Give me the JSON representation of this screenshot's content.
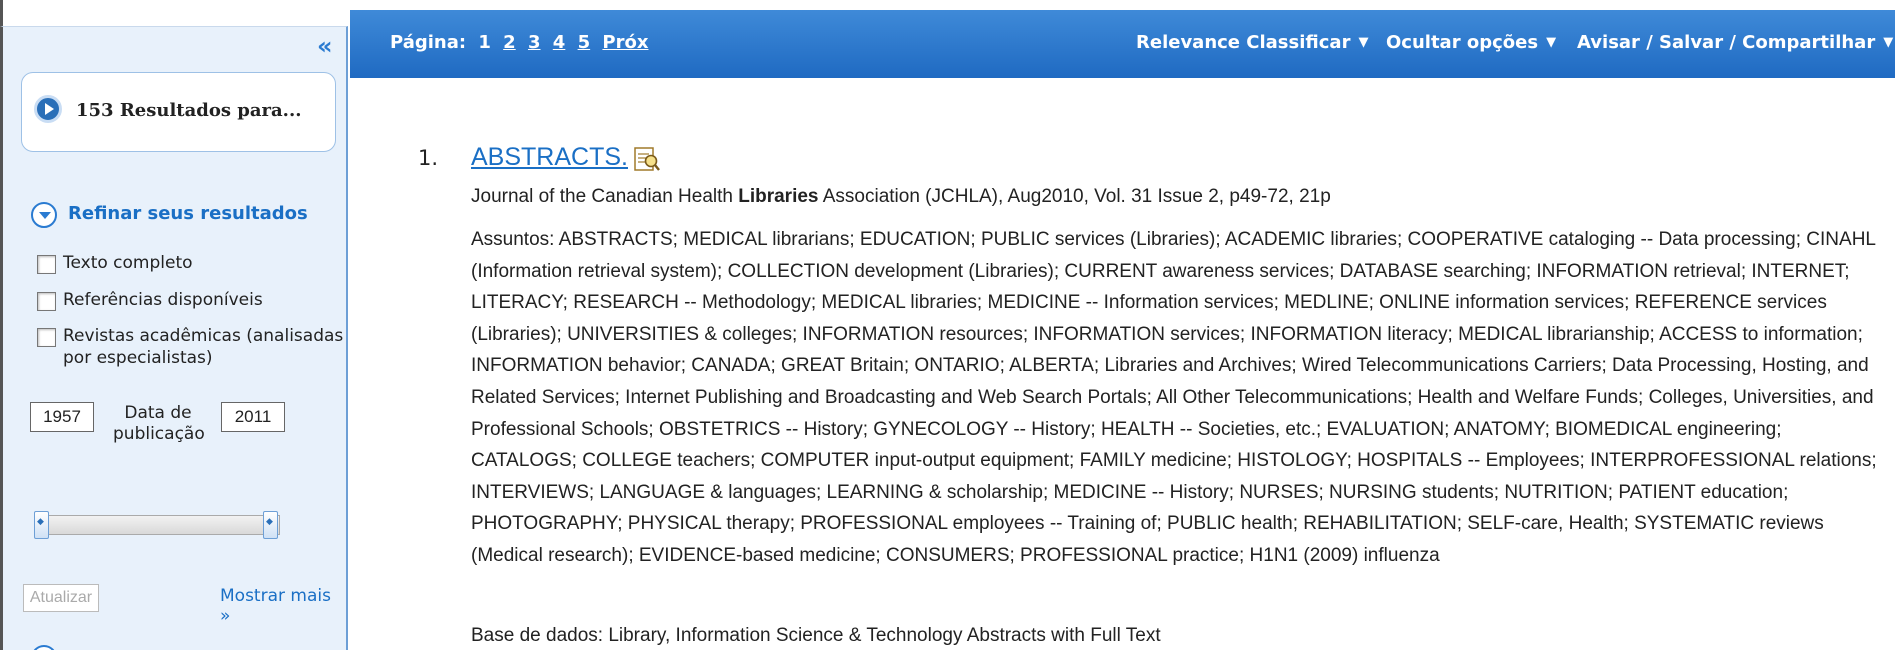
{
  "sidebar": {
    "collapse_glyph": "«",
    "results_label": "153 Resultados para...",
    "refine_label": "Refinar seus resultados",
    "filters": [
      {
        "label": "Texto completo",
        "checked": false
      },
      {
        "label": "Referências disponíveis",
        "checked": false
      },
      {
        "label": "Revistas acadêmicas (analisadas por especialistas)",
        "checked": false
      }
    ],
    "date_from": "1957",
    "date_to": "2011",
    "date_label": "Data de publicação",
    "update_button": "Atualizar",
    "show_more": "Mostrar mais »"
  },
  "toolbar": {
    "page_label": "Página:",
    "current_page": "1",
    "pages": [
      "2",
      "3",
      "4",
      "5"
    ],
    "next": "Próx",
    "sort": "Relevance Classificar",
    "hide_options": "Ocultar opções",
    "share": "Avisar / Salvar / Compartilhar"
  },
  "results": [
    {
      "number": "1.",
      "title": "ABSTRACTS.",
      "source_pre": "Journal of the Canadian Health ",
      "source_bold": "Libraries",
      "source_post": " Association (JCHLA), Aug2010, Vol. 31 Issue 2, p49-72, 21p",
      "subjects": "Assuntos: ABSTRACTS; MEDICAL librarians; EDUCATION; PUBLIC services (Libraries); ACADEMIC libraries; COOPERATIVE cataloging -- Data processing; CINAHL (Information retrieval system); COLLECTION development (Libraries); CURRENT awareness services; DATABASE searching; INFORMATION retrieval; INTERNET; LITERACY; RESEARCH -- Methodology; MEDICAL libraries; MEDICINE -- Information services; MEDLINE; ONLINE information services; REFERENCE services (Libraries); UNIVERSITIES & colleges; INFORMATION resources; INFORMATION services; INFORMATION literacy; MEDICAL librarianship; ACCESS to information; INFORMATION behavior; CANADA; GREAT Britain; ONTARIO; ALBERTA; Libraries and Archives; Wired Telecommunications Carriers; Data Processing, Hosting, and Related Services; Internet Publishing and Broadcasting and Web Search Portals; All Other Telecommunications; Health and Welfare Funds; Colleges, Universities, and Professional Schools; OBSTETRICS -- History; GYNECOLOGY -- History; HEALTH -- Societies, etc.; EVALUATION; ANATOMY; BIOMEDICAL engineering; CATALOGS; COLLEGE teachers; COMPUTER input-output equipment; FAMILY medicine; HISTOLOGY; HOSPITALS -- Employees; INTERPROFESSIONAL relations; INTERVIEWS; LANGUAGE & languages; LEARNING & scholarship; MEDICINE -- History; NURSES; NURSING students; NUTRITION; PATIENT education; PHOTOGRAPHY; PHYSICAL therapy; PROFESSIONAL employees -- Training of; PUBLIC health; REHABILITATION; SELF-care, Health; SYSTEMATIC reviews (Medical research); EVIDENCE-based medicine; CONSUMERS; PROFESSIONAL practice; H1N1 (2009) influenza",
      "database": "Base de dados: Library, Information Science & Technology Abstracts with Full Text"
    }
  ],
  "icons": {
    "preview": "preview-icon",
    "chevron": "chevron-down-icon"
  },
  "colors": {
    "bar_blue": "#2a78cc",
    "link_blue": "#1a6fc5",
    "sidebar_bg": "#e8f1fb"
  }
}
